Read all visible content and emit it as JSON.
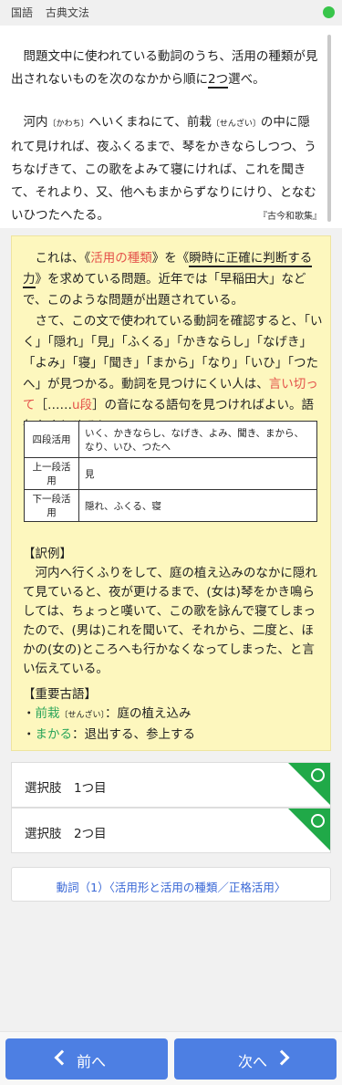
{
  "header": {
    "subject": "国語",
    "topic": "古典文法"
  },
  "question": {
    "prompt_a": "問題文中に使われている動詞のうち、活用の種類が見出されないものを次のなかから順に",
    "prompt_b": "2つ",
    "prompt_c": "選べ。",
    "passage_1": "河内",
    "passage_ruby_1": "〔かわち〕",
    "passage_2": "へいくまねにて、前栽",
    "passage_ruby_2": "〔せんざい〕",
    "passage_3": "の中に隠れて見ければ、夜ふくるまで、琴をかきならしつつ、うちなげきて、この歌をよみて寝にければ、これを聞きて、それより、又、他へもまからずなりにけり、となむいひつたへたる。",
    "source": "『古今和歌集』"
  },
  "explanation": {
    "p1_a": "これは、《",
    "p1_b": "活用の種類",
    "p1_c": "》を《",
    "p1_d": "瞬時に正確に判断する力",
    "p1_e": "》を求めている問題。近年では「早稲田大」などで、このような問題が出題されている。",
    "p2_a": "さて、この文で使われている動詞を確認すると、「いく」「隠れ」「見」「ふくる」「かきならし」「なげき」「よみ」「寝」「聞き」「まから」「なり」「いひ」「つたへ」が見つかる。動詞を見つけにくい人は、",
    "p2_b": "言い切って",
    "p2_c": "［……",
    "p2_d": "u段",
    "p2_e": "］の音になる語句を見つければよい。語句をまとめると……、",
    "table": [
      {
        "type": "四段活用",
        "verbs": "いく、かきならし、なげき、よみ、聞き、まから、なり、いひ、つたへ"
      },
      {
        "type": "上一段活用",
        "verbs": "見"
      },
      {
        "type": "下一段活用",
        "verbs": "隠れ、ふくる、寝"
      }
    ],
    "trans_title": "【訳例】",
    "trans_body": "河内へ行くふりをして、庭の植え込みのなかに隠れて見ていると、夜が更けるまで、(女は)琴をかき鳴らしては、ちょっと嘆いて、この歌を詠んで寝てしまったので、(男は)これを聞いて、それから、二度と、ほかの(女の)ところへも行かなくなってしまった、と言い伝えている。",
    "vocab_title": "【重要古語】",
    "vocab_1_word": "前栽",
    "vocab_1_ruby": "〔せんざい〕",
    "vocab_1_def": "：庭の植え込み",
    "vocab_2_word": "まかる",
    "vocab_2_def": "：退出する、参上する"
  },
  "choices": [
    {
      "label": "選択肢　1つ目"
    },
    {
      "label": "選択肢　2つ目"
    }
  ],
  "related_link": "動詞（1）〈活用形と活用の種類／正格活用〉",
  "footer": {
    "prev": "前へ",
    "next": "次へ"
  },
  "colors": {
    "accent": "#4d7fe3",
    "correct": "#20a948",
    "highlight": "#e4534b"
  }
}
